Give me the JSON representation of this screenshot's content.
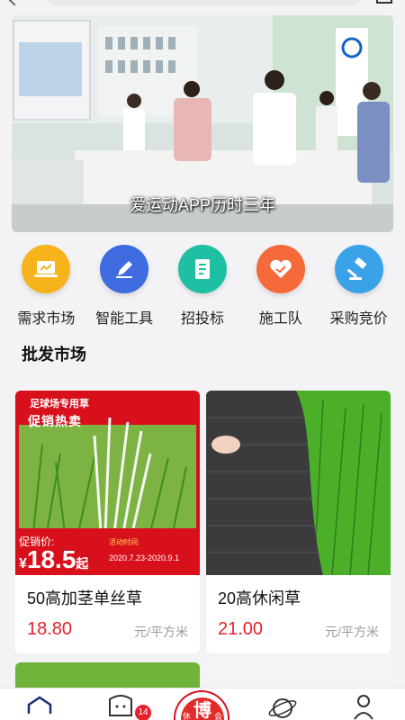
{
  "banner": {
    "caption": "爱运动APP历时三年"
  },
  "categories": [
    {
      "label": "需求市场",
      "icon": "laptop-icon",
      "color": "#f6b31c"
    },
    {
      "label": "智能工具",
      "icon": "pen-icon",
      "color": "#3f6be0"
    },
    {
      "label": "招投标",
      "icon": "document-icon",
      "color": "#1fbfa4"
    },
    {
      "label": "施工队",
      "icon": "handshake-icon",
      "color": "#f46a3b"
    },
    {
      "label": "采购竞价",
      "icon": "auction-hammer-icon",
      "color": "#3aa2e8"
    }
  ],
  "section": {
    "title": "批发市场"
  },
  "products": [
    {
      "name": "50高加茎单丝草",
      "price": "18.80",
      "unit": "元/平方米",
      "promo": {
        "tag": "足球场专用草",
        "headline": "促销热卖",
        "price_label": "促销价:",
        "currency": "¥",
        "price": "18.5",
        "suffix": "起",
        "date_label": "活动时间:",
        "date_range": "2020.7.23-2020.9.1"
      }
    },
    {
      "name": "20高休闲草",
      "price": "21.00",
      "unit": "元/平方米"
    }
  ],
  "tabbar": {
    "badge_count": "14",
    "center_label": "博",
    "center_left": "休",
    "center_right": "会"
  },
  "colors": {
    "accent_red": "#e6202a",
    "promo_red": "#d8101c"
  }
}
